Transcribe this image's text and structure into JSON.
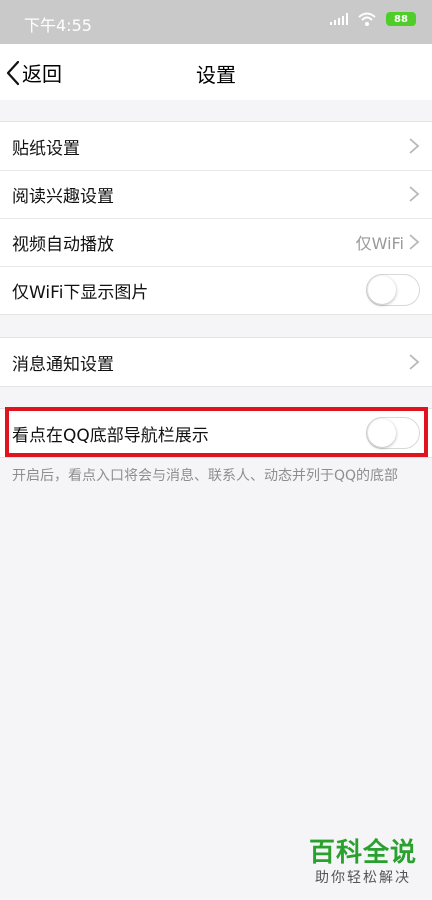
{
  "status_bar": {
    "time": "下午4:55",
    "battery": "88"
  },
  "nav": {
    "back_label": "返回",
    "title": "设置"
  },
  "group1": [
    {
      "label": "贴纸设置",
      "value": "",
      "control": "chevron"
    },
    {
      "label": "阅读兴趣设置",
      "value": "",
      "control": "chevron"
    },
    {
      "label": "视频自动播放",
      "value": "仅WiFi",
      "control": "chevron"
    },
    {
      "label": "仅WiFi下显示图片",
      "value": "",
      "control": "toggle",
      "on": false
    }
  ],
  "group2": [
    {
      "label": "消息通知设置",
      "value": "",
      "control": "chevron"
    }
  ],
  "group3": [
    {
      "label": "看点在QQ底部导航栏展示",
      "value": "",
      "control": "toggle",
      "on": false
    }
  ],
  "caption": "开启后，看点入口将会与消息、联系人、动态并列于QQ的底部",
  "watermark": {
    "title": "百科全说",
    "subtitle": "助你轻松解决"
  },
  "colors": {
    "highlight": "#e0141e",
    "battery": "#4fce2a",
    "watermark": "#2aa12f"
  }
}
